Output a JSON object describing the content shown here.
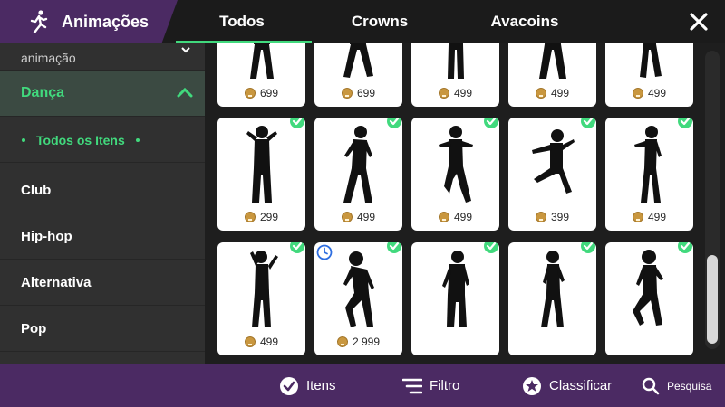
{
  "header": {
    "title": "Animações",
    "title_icon": "walking-person-icon",
    "tabs": [
      {
        "label": "Todos",
        "active": true
      },
      {
        "label": "Crowns",
        "active": false
      },
      {
        "label": "Avacoins",
        "active": false
      }
    ],
    "close_icon": "close-icon"
  },
  "sidebar": {
    "cut_item": "animação",
    "category": "Dança",
    "sub_item": "Todos os Itens",
    "items": [
      "Club",
      "Hip-hop",
      "Alternativa",
      "Pop"
    ]
  },
  "grid": {
    "rows": [
      [
        {
          "price": "699",
          "owned": false
        },
        {
          "price": "699",
          "owned": false
        },
        {
          "price": "499",
          "owned": false
        },
        {
          "price": "499",
          "owned": false
        },
        {
          "price": "499",
          "owned": false
        }
      ],
      [
        {
          "price": "299",
          "owned": true
        },
        {
          "price": "499",
          "owned": true
        },
        {
          "price": "499",
          "owned": true
        },
        {
          "price": "399",
          "owned": true
        },
        {
          "price": "499",
          "owned": true
        }
      ],
      [
        {
          "price": "499",
          "owned": true
        },
        {
          "price": "2 999",
          "owned": true,
          "timed": true
        },
        {
          "price": "",
          "owned": true
        },
        {
          "price": "",
          "owned": true
        },
        {
          "price": "",
          "owned": true
        }
      ]
    ]
  },
  "toolbar": {
    "items_label": "Itens",
    "filter_label": "Filtro",
    "sort_label": "Classificar",
    "search_label": "Pesquisa"
  },
  "colors": {
    "accent": "#41d97d",
    "header_purple": "#4b2a63",
    "sidebar_bg": "#303030",
    "coin": "#c9973f"
  }
}
